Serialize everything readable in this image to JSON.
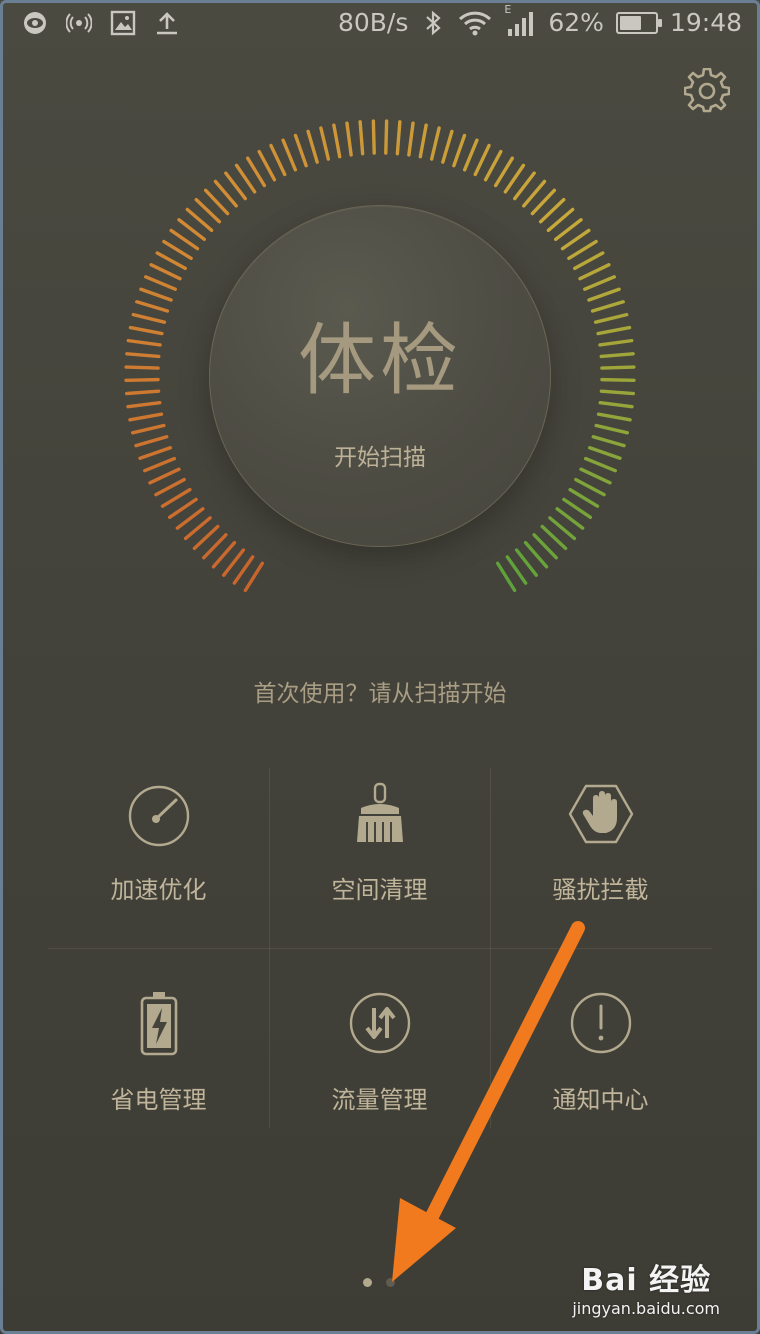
{
  "status_bar": {
    "net_speed": "80B/s",
    "network_type": "E",
    "battery_percent": "62%",
    "battery_level": 0.62,
    "time": "19:48",
    "left_icons": [
      "eye-icon",
      "hotspot-icon",
      "image-icon",
      "upload-icon"
    ],
    "right_icons": [
      "bluetooth-icon",
      "wifi-icon",
      "signal-icon",
      "battery-icon"
    ]
  },
  "header": {
    "settings_icon": "gear-icon"
  },
  "scan": {
    "title": "体检",
    "subtitle": "开始扫描",
    "hint": "首次使用？请从扫描开始",
    "ring_colors": [
      "#c9652c",
      "#d28a35",
      "#c7a83a",
      "#5fa23a"
    ]
  },
  "tools": [
    {
      "label": "加速优化",
      "icon": "speedometer-icon"
    },
    {
      "label": "空间清理",
      "icon": "brush-icon"
    },
    {
      "label": "骚扰拦截",
      "icon": "hand-block-icon"
    },
    {
      "label": "省电管理",
      "icon": "battery-charge-icon"
    },
    {
      "label": "流量管理",
      "icon": "data-traffic-icon"
    },
    {
      "label": "通知中心",
      "icon": "notification-icon"
    }
  ],
  "pager": {
    "current": 1,
    "total": 2
  },
  "watermark": {
    "logo": "Bai 经验",
    "url": "jingyan.baidu.com"
  }
}
